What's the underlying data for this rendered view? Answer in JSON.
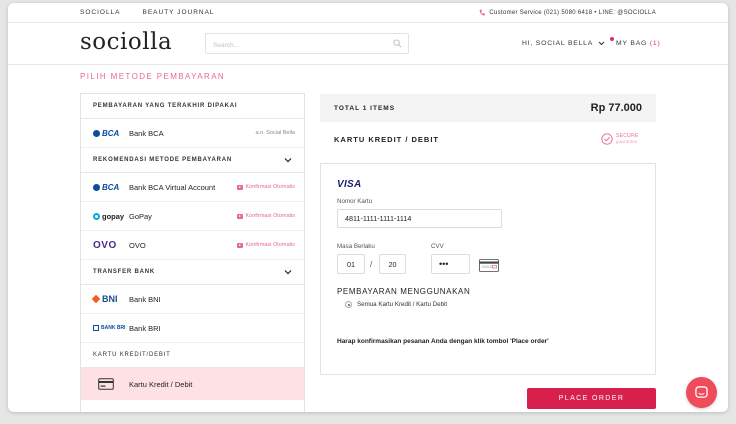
{
  "topbar": {
    "links": [
      "SOCIOLLA",
      "BEAUTY JOURNAL"
    ],
    "contact": "Customer Service (021) 5080 6418 • LINE: @SOCIOLLA"
  },
  "header": {
    "logo": "sociolla",
    "search_placeholder": "Search...",
    "greeting": "HI, SOCIAL BELLA",
    "bag_label": "MY BAG",
    "bag_count": "(1)",
    "accent_color": "#e42c64"
  },
  "page_title": "PILIH METODE PEMBAYARAN",
  "payment": {
    "last_used_heading": "PEMBAYARAN YANG TERAKHIR DIPAKAI",
    "last_used": {
      "logo": "BCA",
      "label": "Bank BCA",
      "note": "a.n. Social Bella"
    },
    "recommended_heading": "REKOMENDASI METODE PEMBAYARAN",
    "recommended": [
      {
        "logo": "BCA",
        "label": "Bank BCA Virtual Account",
        "badge": "Konfirmasi Otomatis"
      },
      {
        "logo": "gopay",
        "label": "GoPay",
        "badge": "Konfirmasi Otomatis"
      },
      {
        "logo": "OVO",
        "label": "OVO",
        "badge": "Konfirmasi Otomatis"
      }
    ],
    "transfer_heading": "TRANSFER BANK",
    "transfer": [
      {
        "logo": "BNI",
        "label": "Bank BNI"
      },
      {
        "logo": "BANK BRI",
        "label": "Bank BRI"
      }
    ],
    "card_heading": "KARTU KREDIT/DEBIT",
    "card_option": {
      "icon": "credit-card-icon",
      "label": "Kartu Kredit / Debit"
    }
  },
  "summary": {
    "total_label": "TOTAL 1 ITEMS",
    "total_amount": "Rp 77.000"
  },
  "card_form": {
    "title": "KARTU KREDIT / DEBIT",
    "secure_line1": "SECURE",
    "secure_line2": "guarantee",
    "brand": "VISA",
    "card_number_label": "Nomor Kartu",
    "card_number_value": "4811-1111-1111-1114",
    "expiry_label": "Masa Berlaku",
    "expiry_month": "01",
    "expiry_year": "20",
    "cvv_label": "CVV",
    "cvv_value": "•••",
    "payment_using_heading": "PEMBAYARAN MENGGUNAKAN",
    "payment_using_option": "Semua Kartu Kredit / Kartu Debit",
    "confirm_text": "Harap konfirmasikan pesanan Anda dengan klik tombol 'Place order'"
  },
  "place_order_label": "PLACE ORDER",
  "colors": {
    "primary_button": "#d7204c",
    "pink_text": "#e86a8f",
    "selected_bg": "#fde1e4"
  }
}
